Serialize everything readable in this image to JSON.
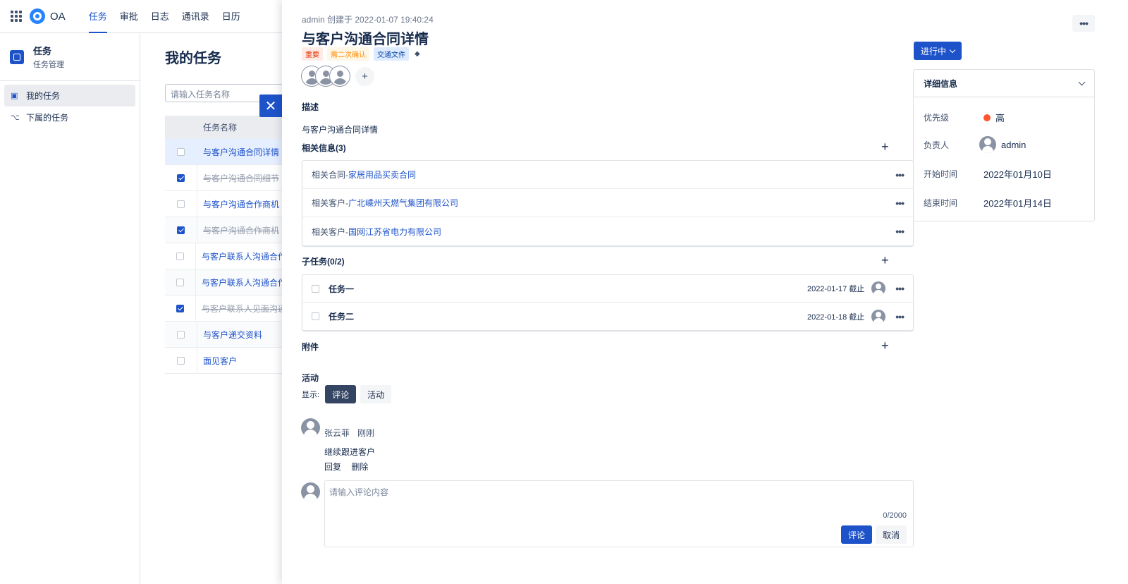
{
  "topnav": {
    "brand": "OA",
    "items": [
      {
        "label": "任务",
        "active": true
      },
      {
        "label": "审批"
      },
      {
        "label": "日志"
      },
      {
        "label": "通讯录"
      },
      {
        "label": "日历"
      }
    ]
  },
  "sidebar": {
    "title": "任务",
    "subtitle": "任务管理",
    "items": [
      {
        "label": "我的任务",
        "icon": "calendar-icon",
        "active": true
      },
      {
        "label": "下属的任务",
        "icon": "org-tree-icon"
      }
    ]
  },
  "main": {
    "title": "我的任务",
    "search_placeholder": "请输入任务名称",
    "table": {
      "column_name": "任务名称",
      "rows": [
        {
          "name": "与客户沟通合同详情",
          "checked": false,
          "done": false
        },
        {
          "name": "与客户沟通合同细节",
          "checked": true,
          "done": true
        },
        {
          "name": "与客户沟通合作商机",
          "checked": false,
          "done": false
        },
        {
          "name": "与客户沟通合作商机",
          "checked": true,
          "done": true
        },
        {
          "name": "与客户联系人沟通合作",
          "checked": false,
          "done": false
        },
        {
          "name": "与客户联系人沟通合作",
          "checked": false,
          "done": false
        },
        {
          "name": "与客户联系人见面沟通",
          "checked": true,
          "done": true
        },
        {
          "name": "与客户递交资料",
          "checked": false,
          "done": false
        },
        {
          "name": "面见客户",
          "checked": false,
          "done": false
        }
      ]
    }
  },
  "detail": {
    "meta": "admin 创建于 2022-01-07 19:40:24",
    "title": "与客户沟通合同详情",
    "tags": [
      {
        "label": "重要",
        "color": "#de350b"
      },
      {
        "label": "需二次确认",
        "color": "#ff8b00"
      },
      {
        "label": "交通文件",
        "color": "#0747a6"
      }
    ],
    "description_label": "描述",
    "description": "与客户沟通合同详情",
    "related_label": "相关信息(3)",
    "related": [
      {
        "prefix": "相关合同-",
        "link": "家居用品买卖合同"
      },
      {
        "prefix": "相关客户-",
        "link": "广北嵊州天燃气集团有限公司"
      },
      {
        "prefix": "相关客户-",
        "link": "国网江苏省电力有限公司"
      }
    ],
    "subtasks_label": "子任务(0/2)",
    "subtasks": [
      {
        "name": "任务一",
        "due": "2022-01-17 截止"
      },
      {
        "name": "任务二",
        "due": "2022-01-18 截止"
      }
    ],
    "attachments_label": "附件",
    "activity_label": "活动",
    "show_label": "显示:",
    "filter_comment": "评论",
    "filter_activity": "活动",
    "comment": {
      "author": "张云菲",
      "time": "刚刚",
      "text": "继续跟进客户",
      "reply": "回复",
      "delete": "删除"
    },
    "input": {
      "placeholder": "请输入评论内容",
      "count": "0/2000",
      "submit": "评论",
      "cancel": "取消"
    },
    "status": "进行中",
    "info": {
      "header": "详细信息",
      "priority_label": "优先级",
      "priority_value": "高",
      "owner_label": "负责人",
      "owner_value": "admin",
      "start_label": "开始时间",
      "start_value": "2022年01月10日",
      "end_label": "结束时间",
      "end_value": "2022年01月14日"
    }
  }
}
